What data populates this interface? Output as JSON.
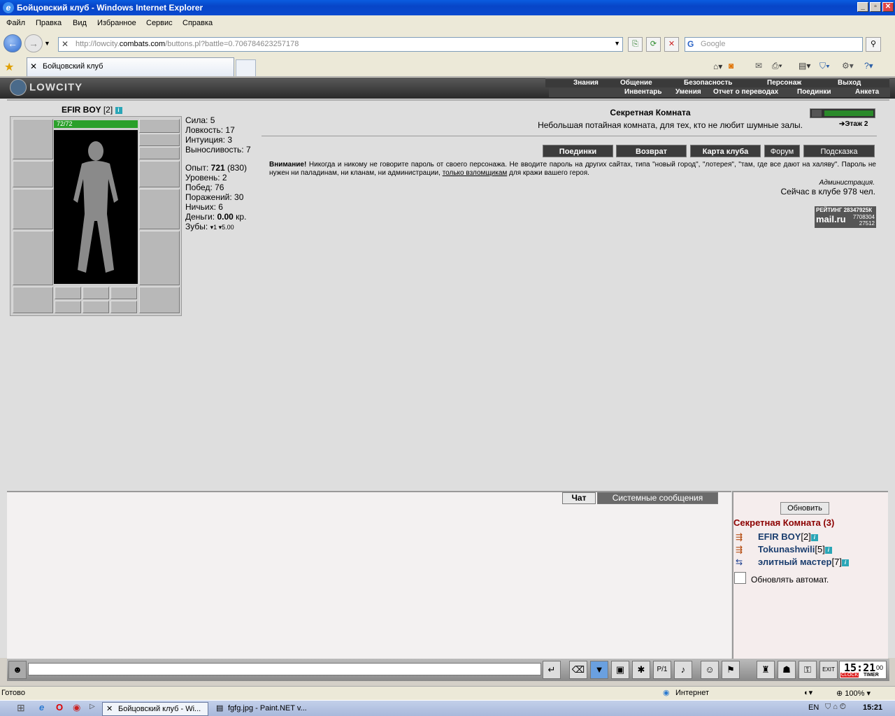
{
  "window": {
    "title": "Бойцовский клуб - Windows Internet Explorer",
    "buttons": [
      "_",
      "▫",
      "✕"
    ]
  },
  "menu": [
    "Файл",
    "Правка",
    "Вид",
    "Избранное",
    "Сервис",
    "Справка"
  ],
  "nav": {
    "url_prefix": "http://lowcity.",
    "url_domain": "combats.com",
    "url_suffix": "/buttons.pl?battle=0.706784623257178",
    "search_placeholder": "Google"
  },
  "tabs": {
    "active": "Бойцовский клуб"
  },
  "game_header": {
    "logo": "LOWCITY",
    "top_links": [
      "Знания",
      "Общение",
      "Безопасность",
      "Персонаж",
      "Выход"
    ],
    "bottom_links": [
      "Инвентарь",
      "Умения",
      "Отчет о переводах",
      "Поединки",
      "Анкета"
    ]
  },
  "character": {
    "name": "EFIR BOY",
    "level": "[2]",
    "hp": "72/72",
    "hp_fraction": 1.0,
    "stats": {
      "strength": "Сила: 5",
      "agility": "Ловкость: 17",
      "intuition": "Интуиция: 3",
      "endurance": "Выносливость: 7"
    },
    "exp_label": "Опыт:",
    "exp_value": "721",
    "exp_next": "(830)",
    "level_line": "Уровень: 2",
    "wins": "Побед: 76",
    "losses": "Поражений: 30",
    "draws": "Ничьих: 6",
    "money_label": "Деньги:",
    "money_value": "0.00",
    "money_unit": "кр.",
    "teeth_label": "Зубы:",
    "teeth_a": "1",
    "teeth_b": "5.00"
  },
  "room": {
    "title": "Секретная Комната",
    "description": "Небольшая потайная комната, для тех, кто не любит шумные залы.",
    "floor": "Этаж 2",
    "buttons": [
      "Поединки",
      "Возврат",
      "Карта клуба",
      "Форум",
      "Подсказка"
    ],
    "warning_bold": "Внимание!",
    "warning_text": " Никогда и никому не говорите пароль от своего персонажа. Не вводите пароль на других сайтах, типа \"новый город\", \"лотерея\", \"там, где все дают на халяву\". Пароль не нужен ни паладинам, ни кланам, ни администрации, ",
    "warning_link": "только взломщикам",
    "warning_end": " для кражи вашего героя.",
    "admin": "Администрация.",
    "online": "Сейчас в клубе 978 чел.",
    "rating": {
      "label": "РЕЙТИНГ",
      "v1": "28347925К",
      "v2": "7708304",
      "v3": "27512",
      "brand": "mail.ru"
    }
  },
  "chat": {
    "tab_chat": "Чат",
    "tab_system": "Системные сообщения"
  },
  "users_panel": {
    "refresh": "Обновить",
    "room": "Секретная Комната (3)",
    "users": [
      {
        "name": "EFIR BOY",
        "level": "[2]"
      },
      {
        "name": "Tokunashwili",
        "level": "[5]"
      },
      {
        "name": "элитный мастер",
        "level": "[7]"
      }
    ],
    "auto_refresh": "Обновлять автомат."
  },
  "clock": {
    "time": "15:21",
    "sec": "00",
    "label_clock": "CLOCK",
    "label_timer": "TIMER"
  },
  "statusbar": {
    "left": "Готово",
    "zone": "Интернет",
    "zoom": "100%"
  },
  "taskbar": {
    "tasks": [
      "Бойцовский клуб - Wi...",
      "fgfg.jpg - Paint.NET v..."
    ],
    "lang": "EN",
    "time": "15:21"
  }
}
